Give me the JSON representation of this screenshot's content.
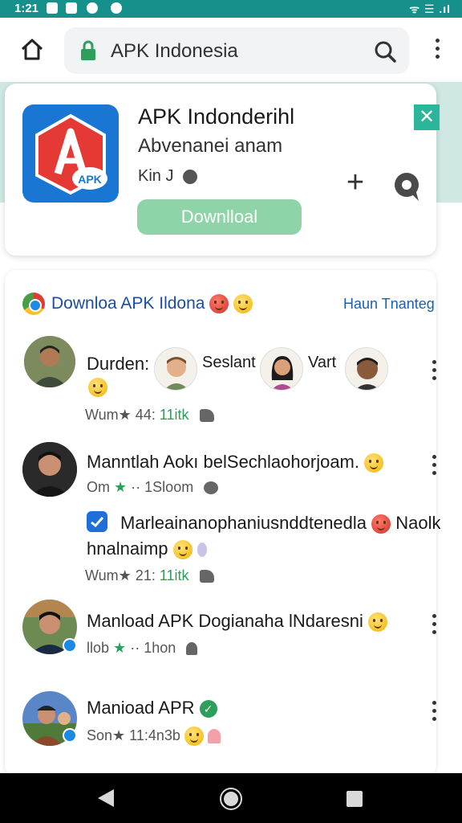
{
  "status_bar": {
    "time": "1:21",
    "right_text": "ᯤ ☰ .ıl"
  },
  "browser": {
    "url": "APK Indonesia"
  },
  "app_card": {
    "title": "APK Indonderihl",
    "subtitle": "Abvenanei anam",
    "meta": "Kin J",
    "download_label": "Downlloal",
    "logo_badge": "APK",
    "close_glyph": "✕",
    "plus_glyph": "+"
  },
  "feed": {
    "title": "Downloa APK Ildona",
    "link": "Haun Tnanteg",
    "posts": [
      {
        "name_parts": [
          "Durden:",
          "Seslant",
          "Vart"
        ],
        "meta_prefix": "Wum★ 44:",
        "meta_count": "11itk"
      },
      {
        "name": "Manntlah Aokı belSechlaohorjoam.",
        "meta_prefix": "Om",
        "meta_star": "★",
        "meta_rest": "·· 1Sloom",
        "message": "Marleainanophaniusnddtenedla",
        "message_tail": "Naolk",
        "message_line2": "hnalnaimp",
        "meta2_prefix": "Wum★ 21:",
        "meta2_count": "11itk"
      },
      {
        "name": "Manload APK Dogianaha lNdaresni",
        "meta_prefix": "llob",
        "meta_star": "★",
        "meta_rest": "·· 1hon"
      },
      {
        "name": "Manioad APR",
        "meta_prefix": "Son★ 11:4n3b"
      }
    ]
  },
  "colors": {
    "status_bar": "#15908a",
    "download_button": "#8fd3a8",
    "accent_green": "#2e9e5b",
    "link_blue": "#1a5fb0"
  }
}
